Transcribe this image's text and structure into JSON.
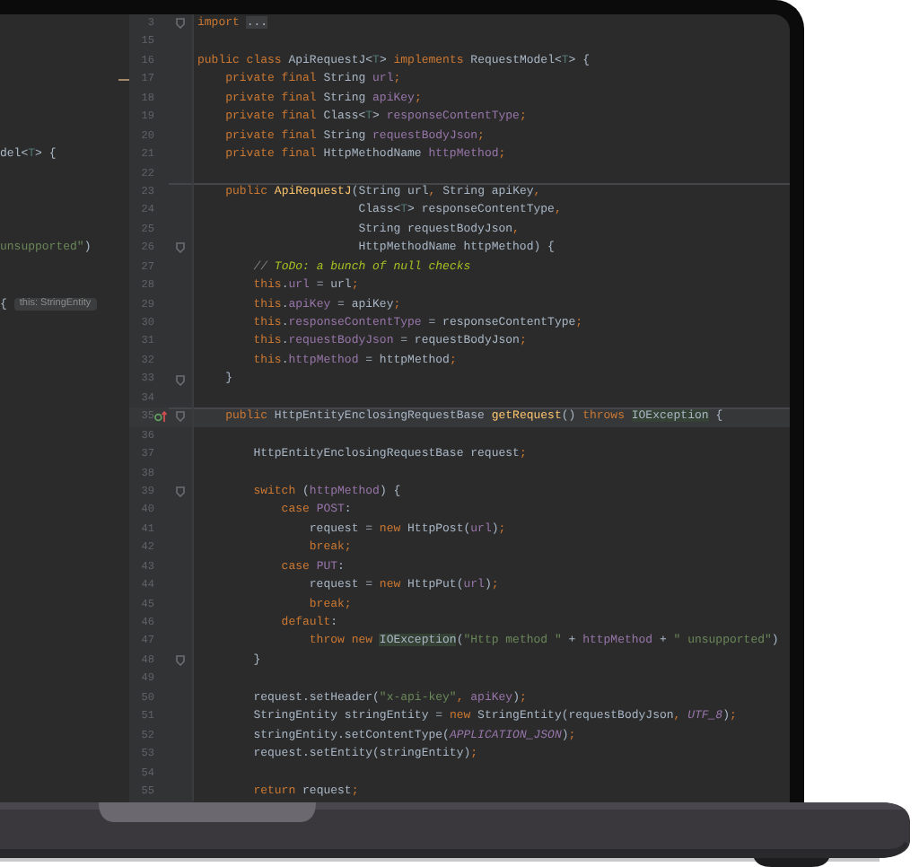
{
  "editor": {
    "lines": [
      {
        "number": "3",
        "fold": true,
        "separator": false,
        "current": false,
        "code": [
          {
            "text": "import ",
            "kind": "k"
          },
          {
            "text": "...",
            "kind": "x"
          }
        ]
      },
      {
        "number": "15",
        "fold": false,
        "separator": false,
        "current": false
      },
      {
        "number": "16",
        "fold": false,
        "separator": false,
        "current": false,
        "code": [
          {
            "text": "public class ",
            "kind": "k"
          },
          {
            "text": "ApiRequestJ<",
            "kind": "p"
          },
          {
            "text": "T",
            "kind": "g"
          },
          {
            "text": "> ",
            "kind": "p"
          },
          {
            "text": "implements ",
            "kind": "k"
          },
          {
            "text": "RequestModel<",
            "kind": "p"
          },
          {
            "text": "T",
            "kind": "g"
          },
          {
            "text": "> {",
            "kind": "p"
          }
        ]
      },
      {
        "number": "17",
        "fold": false,
        "separator": false,
        "current": false,
        "left": {
          "marker": true
        },
        "code": [
          {
            "text": "    private final ",
            "kind": "k"
          },
          {
            "text": "String ",
            "kind": "p"
          },
          {
            "text": "url",
            "kind": "f"
          },
          {
            "text": ";",
            "kind": "k"
          }
        ]
      },
      {
        "number": "18",
        "fold": false,
        "separator": false,
        "current": false,
        "code": [
          {
            "text": "    private final ",
            "kind": "k"
          },
          {
            "text": "String ",
            "kind": "p"
          },
          {
            "text": "apiKey",
            "kind": "f"
          },
          {
            "text": ";",
            "kind": "k"
          }
        ]
      },
      {
        "number": "19",
        "fold": false,
        "separator": false,
        "current": false,
        "code": [
          {
            "text": "    private final ",
            "kind": "k"
          },
          {
            "text": "Class<",
            "kind": "p"
          },
          {
            "text": "T",
            "kind": "g"
          },
          {
            "text": "> ",
            "kind": "p"
          },
          {
            "text": "responseContentType",
            "kind": "f"
          },
          {
            "text": ";",
            "kind": "k"
          }
        ]
      },
      {
        "number": "20",
        "fold": false,
        "separator": false,
        "current": false,
        "code": [
          {
            "text": "    private final ",
            "kind": "k"
          },
          {
            "text": "String ",
            "kind": "p"
          },
          {
            "text": "requestBodyJson",
            "kind": "f"
          },
          {
            "text": ";",
            "kind": "k"
          }
        ]
      },
      {
        "number": "21",
        "fold": false,
        "separator": false,
        "current": false,
        "left": {
          "code": [
            {
              "text": "del<",
              "kind": "p"
            },
            {
              "text": "T",
              "kind": "g"
            },
            {
              "text": "> {",
              "kind": "p"
            }
          ]
        },
        "code": [
          {
            "text": "    private final ",
            "kind": "k"
          },
          {
            "text": "HttpMethodName ",
            "kind": "p"
          },
          {
            "text": "httpMethod",
            "kind": "f"
          },
          {
            "text": ";",
            "kind": "k"
          }
        ]
      },
      {
        "number": "22",
        "fold": false,
        "separator": false,
        "current": false
      },
      {
        "number": "23",
        "fold": false,
        "separator": true,
        "current": false,
        "code": [
          {
            "text": "    public ",
            "kind": "k"
          },
          {
            "text": "ApiRequestJ",
            "kind": "m"
          },
          {
            "text": "(String url",
            "kind": "p"
          },
          {
            "text": ", ",
            "kind": "k"
          },
          {
            "text": "String apiKey",
            "kind": "p"
          },
          {
            "text": ",",
            "kind": "k"
          }
        ]
      },
      {
        "number": "24",
        "fold": false,
        "separator": false,
        "current": false,
        "code": [
          {
            "text": "                       Class<",
            "kind": "p"
          },
          {
            "text": "T",
            "kind": "g"
          },
          {
            "text": "> responseContentType",
            "kind": "p"
          },
          {
            "text": ",",
            "kind": "k"
          }
        ]
      },
      {
        "number": "25",
        "fold": false,
        "separator": false,
        "current": false,
        "code": [
          {
            "text": "                       String requestBodyJson",
            "kind": "p"
          },
          {
            "text": ",",
            "kind": "k"
          }
        ]
      },
      {
        "number": "26",
        "fold": true,
        "separator": false,
        "current": false,
        "left": {
          "code": [
            {
              "text": "unsupported\"",
              "kind": "s"
            },
            {
              "text": ")",
              "kind": "p"
            }
          ]
        },
        "code": [
          {
            "text": "                       HttpMethodName httpMethod) {",
            "kind": "p"
          }
        ]
      },
      {
        "number": "27",
        "fold": false,
        "separator": false,
        "current": false,
        "code": [
          {
            "text": "        // ",
            "kind": "n"
          },
          {
            "text": "ToDo: a bunch of null checks",
            "kind": "t"
          }
        ]
      },
      {
        "number": "28",
        "fold": false,
        "separator": false,
        "current": false,
        "code": [
          {
            "text": "        this",
            "kind": "k"
          },
          {
            "text": ".",
            "kind": "p"
          },
          {
            "text": "url",
            "kind": "f"
          },
          {
            "text": " = url",
            "kind": "p"
          },
          {
            "text": ";",
            "kind": "k"
          }
        ]
      },
      {
        "number": "29",
        "fold": false,
        "separator": false,
        "current": false,
        "left": {
          "code": [
            {
              "text": "{",
              "kind": "p"
            }
          ],
          "hint": "this: StringEntity"
        },
        "code": [
          {
            "text": "        this",
            "kind": "k"
          },
          {
            "text": ".",
            "kind": "p"
          },
          {
            "text": "apiKey",
            "kind": "f"
          },
          {
            "text": " = apiKey",
            "kind": "p"
          },
          {
            "text": ";",
            "kind": "k"
          }
        ]
      },
      {
        "number": "30",
        "fold": false,
        "separator": false,
        "current": false,
        "code": [
          {
            "text": "        this",
            "kind": "k"
          },
          {
            "text": ".",
            "kind": "p"
          },
          {
            "text": "responseContentType",
            "kind": "f"
          },
          {
            "text": " = responseContentType",
            "kind": "p"
          },
          {
            "text": ";",
            "kind": "k"
          }
        ]
      },
      {
        "number": "31",
        "fold": false,
        "separator": false,
        "current": false,
        "code": [
          {
            "text": "        this",
            "kind": "k"
          },
          {
            "text": ".",
            "kind": "p"
          },
          {
            "text": "requestBodyJson",
            "kind": "f"
          },
          {
            "text": " = requestBodyJson",
            "kind": "p"
          },
          {
            "text": ";",
            "kind": "k"
          }
        ]
      },
      {
        "number": "32",
        "fold": false,
        "separator": false,
        "current": false,
        "code": [
          {
            "text": "        this",
            "kind": "k"
          },
          {
            "text": ".",
            "kind": "p"
          },
          {
            "text": "httpMethod",
            "kind": "f"
          },
          {
            "text": " = httpMethod",
            "kind": "p"
          },
          {
            "text": ";",
            "kind": "k"
          }
        ]
      },
      {
        "number": "33",
        "fold": true,
        "separator": false,
        "current": false,
        "code": [
          {
            "text": "    }",
            "kind": "p"
          }
        ]
      },
      {
        "number": "34",
        "fold": false,
        "separator": false,
        "current": false
      },
      {
        "number": "35",
        "fold": true,
        "separator": true,
        "current": true,
        "overrides": true,
        "code": [
          {
            "text": "    public ",
            "kind": "k"
          },
          {
            "text": "HttpEntityEnclosingRequestBase ",
            "kind": "p"
          },
          {
            "text": "getRequest",
            "kind": "m"
          },
          {
            "text": "() ",
            "kind": "p"
          },
          {
            "text": "throws ",
            "kind": "k"
          },
          {
            "text": "IOException",
            "kind": "e"
          },
          {
            "text": " {",
            "kind": "p"
          }
        ]
      },
      {
        "number": "36",
        "fold": false,
        "separator": false,
        "current": false
      },
      {
        "number": "37",
        "fold": false,
        "separator": false,
        "current": false,
        "code": [
          {
            "text": "        HttpEntityEnclosingRequestBase request",
            "kind": "p"
          },
          {
            "text": ";",
            "kind": "k"
          }
        ]
      },
      {
        "number": "38",
        "fold": false,
        "separator": false,
        "current": false
      },
      {
        "number": "39",
        "fold": true,
        "separator": false,
        "current": false,
        "code": [
          {
            "text": "        switch ",
            "kind": "k"
          },
          {
            "text": "(",
            "kind": "p"
          },
          {
            "text": "httpMethod",
            "kind": "f"
          },
          {
            "text": ") {",
            "kind": "p"
          }
        ]
      },
      {
        "number": "40",
        "fold": false,
        "separator": false,
        "current": false,
        "code": [
          {
            "text": "            case ",
            "kind": "k"
          },
          {
            "text": "POST",
            "kind": "f"
          },
          {
            "text": ":",
            "kind": "p"
          }
        ]
      },
      {
        "number": "41",
        "fold": false,
        "separator": false,
        "current": false,
        "code": [
          {
            "text": "                request = ",
            "kind": "p"
          },
          {
            "text": "new ",
            "kind": "k"
          },
          {
            "text": "HttpPost(",
            "kind": "p"
          },
          {
            "text": "url",
            "kind": "f"
          },
          {
            "text": ")",
            "kind": "p"
          },
          {
            "text": ";",
            "kind": "k"
          }
        ]
      },
      {
        "number": "42",
        "fold": false,
        "separator": false,
        "current": false,
        "code": [
          {
            "text": "                break;",
            "kind": "k"
          }
        ]
      },
      {
        "number": "43",
        "fold": false,
        "separator": false,
        "current": false,
        "code": [
          {
            "text": "            case ",
            "kind": "k"
          },
          {
            "text": "PUT",
            "kind": "f"
          },
          {
            "text": ":",
            "kind": "p"
          }
        ]
      },
      {
        "number": "44",
        "fold": false,
        "separator": false,
        "current": false,
        "code": [
          {
            "text": "                request = ",
            "kind": "p"
          },
          {
            "text": "new ",
            "kind": "k"
          },
          {
            "text": "HttpPut(",
            "kind": "p"
          },
          {
            "text": "url",
            "kind": "f"
          },
          {
            "text": ")",
            "kind": "p"
          },
          {
            "text": ";",
            "kind": "k"
          }
        ]
      },
      {
        "number": "45",
        "fold": false,
        "separator": false,
        "current": false,
        "code": [
          {
            "text": "                break;",
            "kind": "k"
          }
        ]
      },
      {
        "number": "46",
        "fold": false,
        "separator": false,
        "current": false,
        "code": [
          {
            "text": "            default",
            "kind": "k"
          },
          {
            "text": ":",
            "kind": "p"
          }
        ]
      },
      {
        "number": "47",
        "fold": false,
        "separator": false,
        "current": false,
        "code": [
          {
            "text": "                throw new ",
            "kind": "k"
          },
          {
            "text": "IOException",
            "kind": "e"
          },
          {
            "text": "(",
            "kind": "p"
          },
          {
            "text": "\"Http method \"",
            "kind": "s"
          },
          {
            "text": " + ",
            "kind": "p"
          },
          {
            "text": "httpMethod",
            "kind": "f"
          },
          {
            "text": " + ",
            "kind": "p"
          },
          {
            "text": "\" unsupported\"",
            "kind": "s"
          },
          {
            "text": ")",
            "kind": "p"
          }
        ]
      },
      {
        "number": "48",
        "fold": true,
        "separator": false,
        "current": false,
        "code": [
          {
            "text": "        }",
            "kind": "p"
          }
        ]
      },
      {
        "number": "49",
        "fold": false,
        "separator": false,
        "current": false
      },
      {
        "number": "50",
        "fold": false,
        "separator": false,
        "current": false,
        "code": [
          {
            "text": "        request.setHeader(",
            "kind": "p"
          },
          {
            "text": "\"x-api-key\"",
            "kind": "s"
          },
          {
            "text": ", ",
            "kind": "k"
          },
          {
            "text": "apiKey",
            "kind": "f"
          },
          {
            "text": ")",
            "kind": "p"
          },
          {
            "text": ";",
            "kind": "k"
          }
        ]
      },
      {
        "number": "51",
        "fold": false,
        "separator": false,
        "current": false,
        "code": [
          {
            "text": "        StringEntity stringEntity = ",
            "kind": "p"
          },
          {
            "text": "new ",
            "kind": "k"
          },
          {
            "text": "StringEntity(requestBodyJson",
            "kind": "p"
          },
          {
            "text": ", ",
            "kind": "k"
          },
          {
            "text": "UTF_8",
            "kind": "c"
          },
          {
            "text": ")",
            "kind": "p"
          },
          {
            "text": ";",
            "kind": "k"
          }
        ]
      },
      {
        "number": "52",
        "fold": false,
        "separator": false,
        "current": false,
        "code": [
          {
            "text": "        stringEntity.setContentType(",
            "kind": "p"
          },
          {
            "text": "APPLICATION_JSON",
            "kind": "c"
          },
          {
            "text": ")",
            "kind": "p"
          },
          {
            "text": ";",
            "kind": "k"
          }
        ]
      },
      {
        "number": "53",
        "fold": false,
        "separator": false,
        "current": false,
        "code": [
          {
            "text": "        request.setEntity(stringEntity)",
            "kind": "p"
          },
          {
            "text": ";",
            "kind": "k"
          }
        ]
      },
      {
        "number": "54",
        "fold": false,
        "separator": false,
        "current": false
      },
      {
        "number": "55",
        "fold": false,
        "separator": false,
        "current": false,
        "code": [
          {
            "text": "        return ",
            "kind": "k"
          },
          {
            "text": "request",
            "kind": "p"
          },
          {
            "text": ";",
            "kind": "k"
          }
        ]
      }
    ]
  }
}
